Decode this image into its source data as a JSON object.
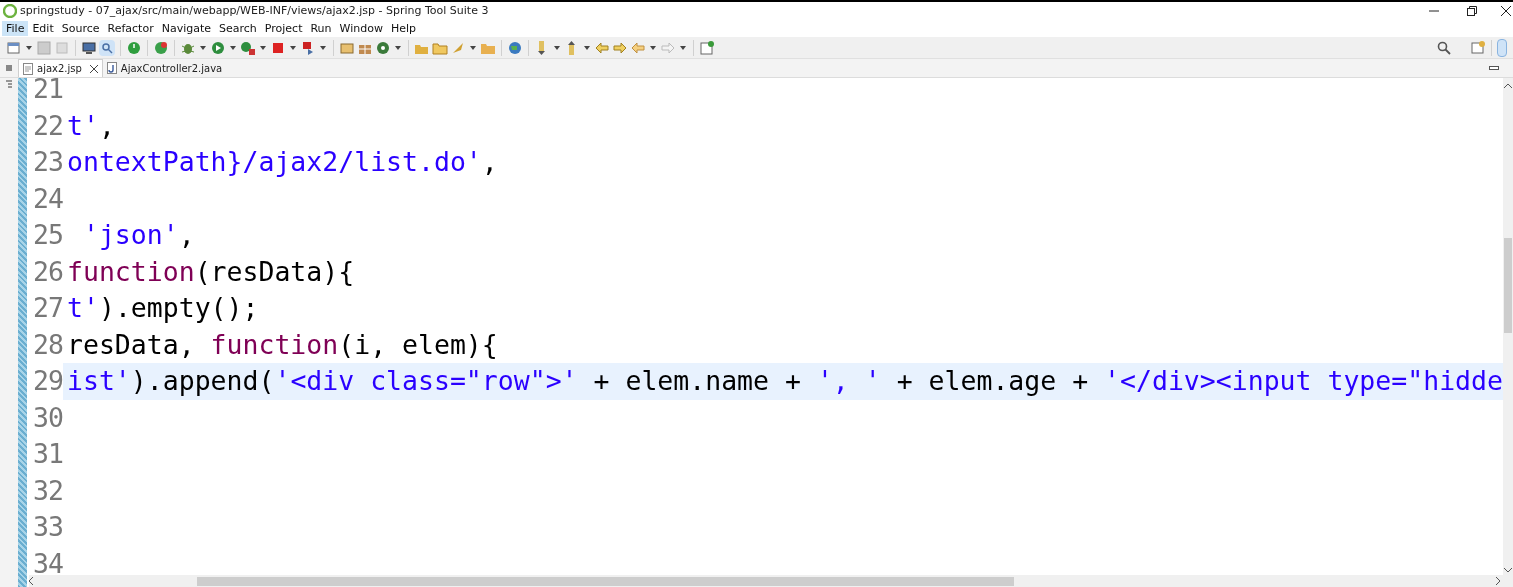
{
  "window": {
    "title": "springstudy - 07_ajax/src/main/webapp/WEB-INF/views/ajax2.jsp - Spring Tool Suite 3"
  },
  "menu": [
    {
      "label": "File",
      "selected": true
    },
    {
      "label": "Edit",
      "selected": false
    },
    {
      "label": "Source",
      "selected": false
    },
    {
      "label": "Refactor",
      "selected": false
    },
    {
      "label": "Navigate",
      "selected": false
    },
    {
      "label": "Search",
      "selected": false
    },
    {
      "label": "Project",
      "selected": false
    },
    {
      "label": "Run",
      "selected": false
    },
    {
      "label": "Window",
      "selected": false
    },
    {
      "label": "Help",
      "selected": false
    }
  ],
  "tabs": [
    {
      "label": "ajax2.jsp",
      "kind": "jsp",
      "selected": true
    },
    {
      "label": "AjaxController2.java",
      "kind": "java",
      "selected": false
    }
  ],
  "editor": {
    "lines": [
      {
        "number": "21",
        "current": false
      },
      {
        "number": "22",
        "current": false,
        "tokens": [
          {
            "kind": "string",
            "text": "t'"
          },
          {
            "kind": "plain",
            "text": ","
          }
        ]
      },
      {
        "number": "23",
        "current": false,
        "tokens": [
          {
            "kind": "string",
            "text": "ontextPath}/ajax2/list.do'"
          },
          {
            "kind": "plain",
            "text": ","
          }
        ]
      },
      {
        "number": "24",
        "current": false
      },
      {
        "number": "25",
        "current": false,
        "tokens": [
          {
            "kind": "string",
            "text": " 'json'"
          },
          {
            "kind": "plain",
            "text": ","
          }
        ]
      },
      {
        "number": "26",
        "current": false,
        "tokens": [
          {
            "kind": "keyword",
            "text": "function"
          },
          {
            "kind": "plain",
            "text": "(resData){"
          }
        ]
      },
      {
        "number": "27",
        "current": false,
        "tokens": [
          {
            "kind": "string",
            "text": "t'"
          },
          {
            "kind": "plain",
            "text": ").empty();"
          }
        ]
      },
      {
        "number": "28",
        "current": false,
        "tokens": [
          {
            "kind": "plain",
            "text": "resData, "
          },
          {
            "kind": "keyword",
            "text": "function"
          },
          {
            "kind": "plain",
            "text": "(i, elem){"
          }
        ]
      },
      {
        "number": "29",
        "current": true,
        "tokens": [
          {
            "kind": "string",
            "text": "ist'"
          },
          {
            "kind": "plain",
            "text": ").append("
          },
          {
            "kind": "string",
            "text": "'<div class=\"row\">'"
          },
          {
            "kind": "plain",
            "text": " + elem.name + "
          },
          {
            "kind": "string",
            "text": "', '"
          },
          {
            "kind": "plain",
            "text": " + elem.age + "
          },
          {
            "kind": "string",
            "text": "'</div><input type=\"hidde"
          }
        ]
      },
      {
        "number": "30",
        "current": false
      },
      {
        "number": "31",
        "current": false
      },
      {
        "number": "32",
        "current": false
      },
      {
        "number": "33",
        "current": false
      },
      {
        "number": "34",
        "current": false
      }
    ]
  }
}
